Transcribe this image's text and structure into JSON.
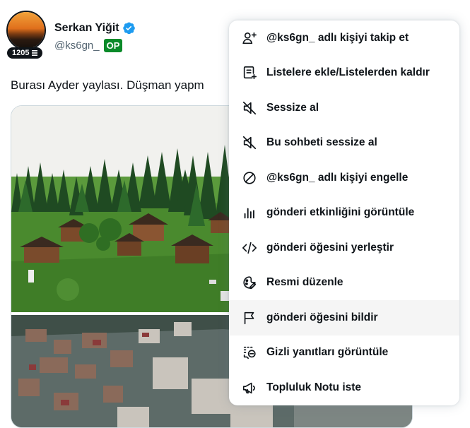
{
  "author": {
    "display_name": "Serkan Yiğit",
    "handle": "@ks6gn_",
    "op_badge": "OP",
    "follow_count": "1205",
    "verified": true
  },
  "tweet": {
    "text": "Burası Ayder yaylası. Düşman yapm"
  },
  "menu": {
    "items": [
      {
        "label": "@ks6gn_ adlı kişiyi takip et",
        "icon": "follow-user-icon"
      },
      {
        "label": "Listelere ekle/Listelerden kaldır",
        "icon": "list-add-icon"
      },
      {
        "label": "Sessize al",
        "icon": "mute-icon"
      },
      {
        "label": "Bu sohbeti sessize al",
        "icon": "mute-conversation-icon"
      },
      {
        "label": "@ks6gn_ adlı kişiyi engelle",
        "icon": "block-icon"
      },
      {
        "label": "gönderi etkinliğini görüntüle",
        "icon": "analytics-icon"
      },
      {
        "label": "gönderi öğesini yerleştir",
        "icon": "embed-code-icon"
      },
      {
        "label": "Resmi düzenle",
        "icon": "edit-image-icon"
      },
      {
        "label": "gönderi öğesini bildir",
        "icon": "report-flag-icon"
      },
      {
        "label": "Gizli yanıtları görüntüle",
        "icon": "hidden-replies-icon"
      },
      {
        "label": "Topluluk Notu iste",
        "icon": "megaphone-icon"
      }
    ]
  },
  "colors": {
    "verified": "#1d9bf0",
    "op_badge": "#0a8a29",
    "text_primary": "#0f1419",
    "text_secondary": "#536471",
    "menu_hover": "#f5f5f5"
  }
}
